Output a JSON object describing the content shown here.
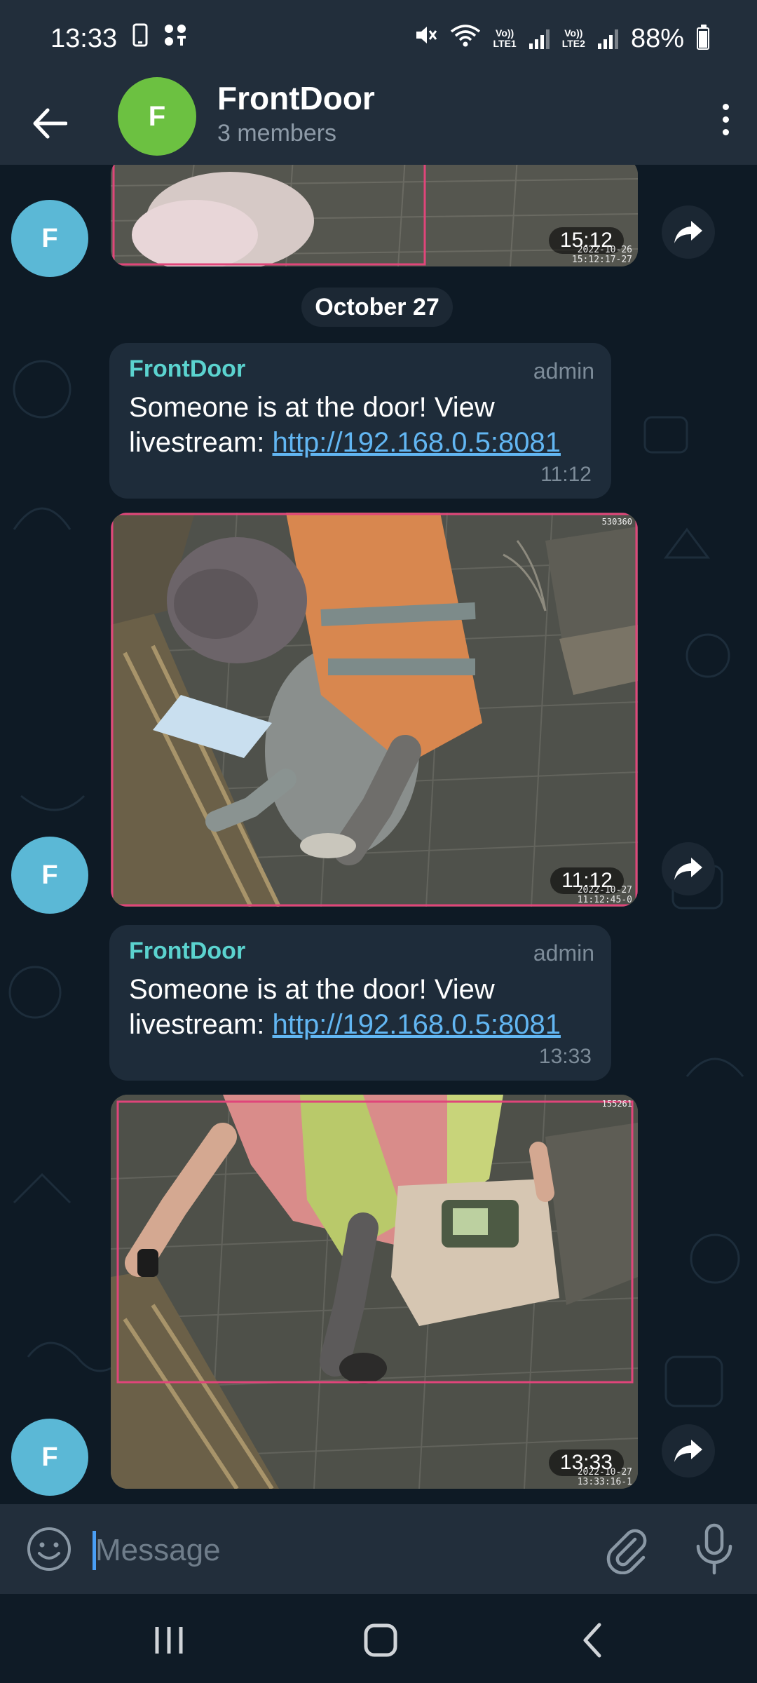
{
  "status_bar": {
    "time": "13:33",
    "lte1": "Vo))\nLTE1",
    "lte1_top": "Vo))",
    "lte1_bottom": "LTE1",
    "lte2_top": "Vo))",
    "lte2_bottom": "LTE2",
    "battery": "88%"
  },
  "header": {
    "avatar_letter": "F",
    "title": "FrontDoor",
    "subtitle": "3 members",
    "avatar_color": "#6cc141"
  },
  "chat": {
    "date_separator": "October 27",
    "sender_avatar_letter": "F",
    "top_photo": {
      "time": "15:12",
      "cam_date": "2022-10-26",
      "cam_time": "15:12:17-27"
    },
    "messages": [
      {
        "sender": "FrontDoor",
        "role": "admin",
        "text_line1": "Someone is at the door! View",
        "text_prefix": "livestream: ",
        "link": "http://192.168.0.5:8081",
        "time": "11:12"
      },
      {
        "sender": "FrontDoor",
        "role": "admin",
        "text_line1": "Someone is at the door! View",
        "text_prefix": "livestream: ",
        "link": "http://192.168.0.5:8081",
        "time": "13:33"
      }
    ],
    "photos": [
      {
        "time": "11:12",
        "cam_corner": "530360",
        "cam_date": "2022-10-27",
        "cam_time": "11:12:45-0"
      },
      {
        "time": "13:33",
        "cam_corner": "155261",
        "cam_date": "2022-10-27",
        "cam_time": "13:33:16-1"
      }
    ]
  },
  "input": {
    "placeholder": "Message"
  },
  "colors": {
    "sender_name": "#5bd3cf",
    "link": "#62b6f2",
    "bubble": "#1e2c3a",
    "header_bg": "#222e3b",
    "sender_avatar": "#5bb8d6"
  }
}
